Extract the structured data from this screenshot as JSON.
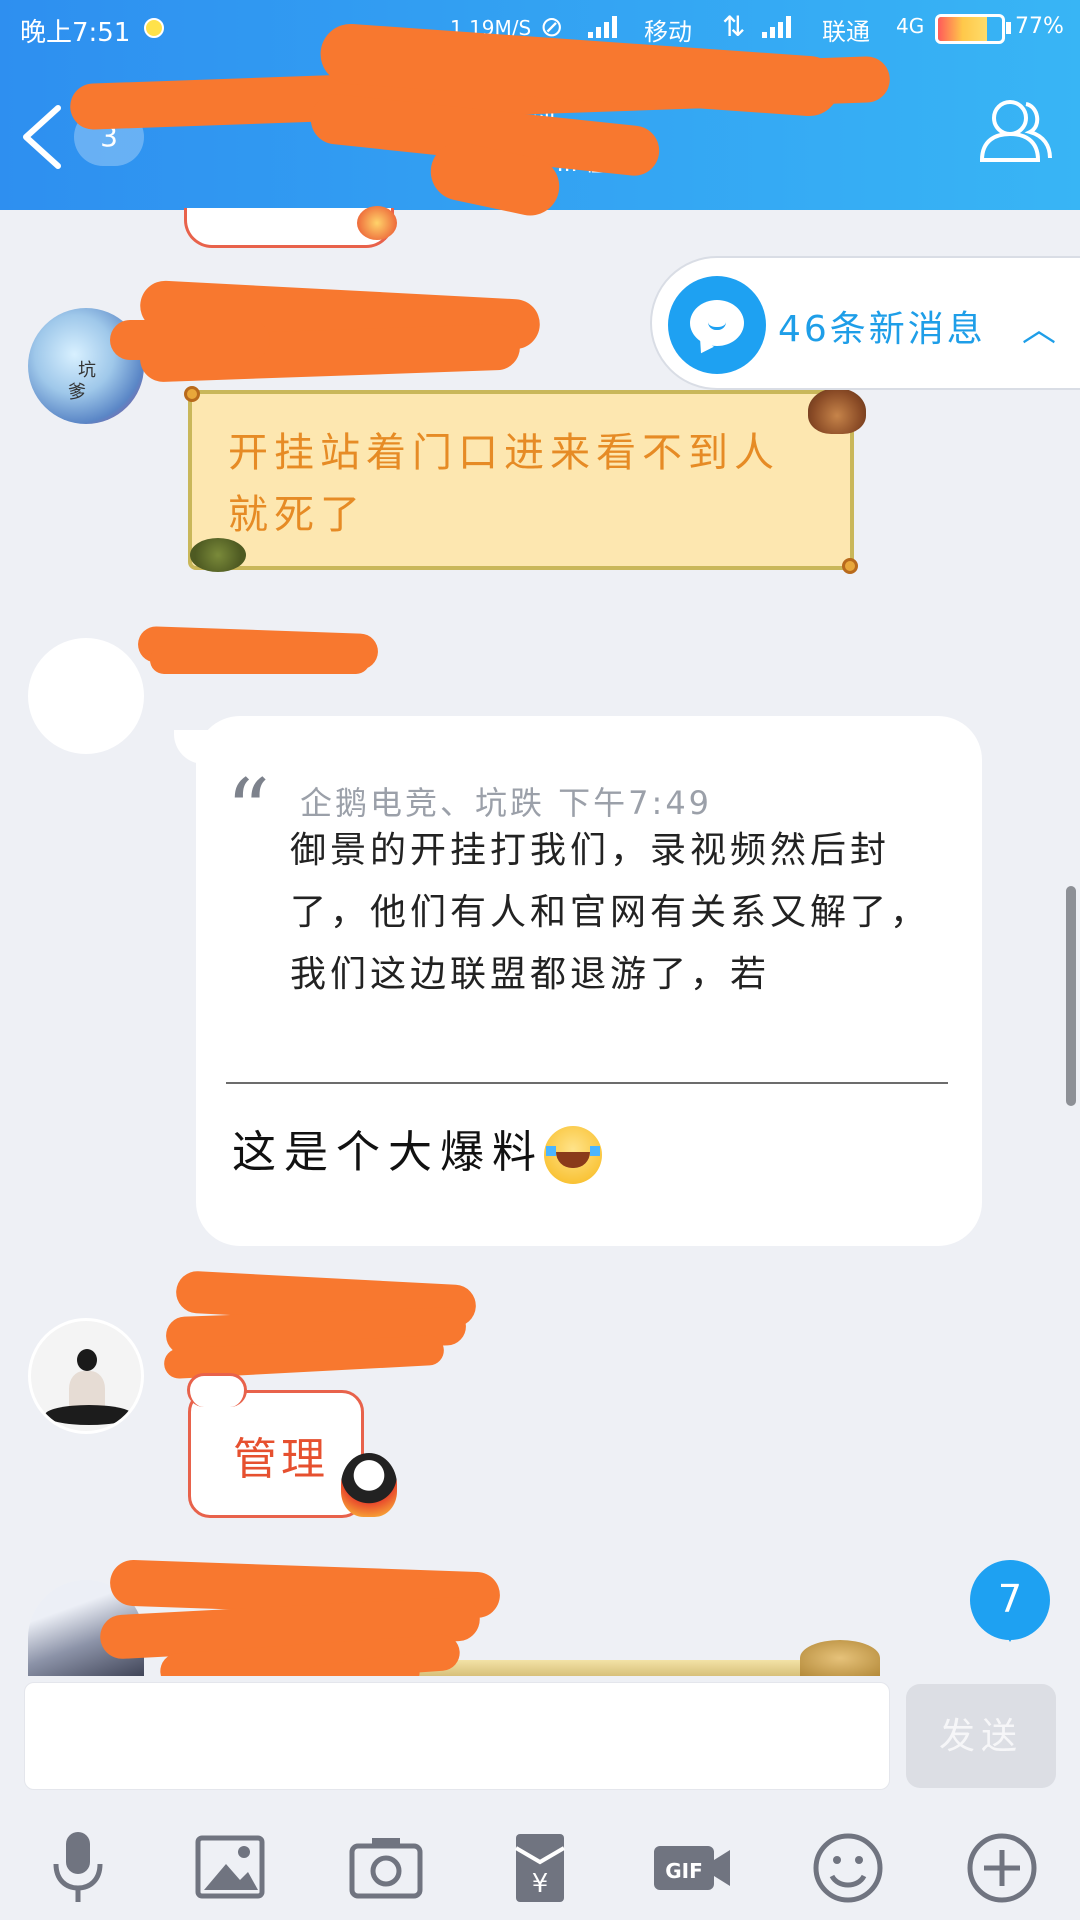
{
  "status_bar": {
    "time": "晚上7:51",
    "net_speed": "1.19M/S",
    "carrier1": "移动",
    "carrier2": "联通",
    "network": "4G",
    "battery": "77%",
    "battery_level": 0.77
  },
  "header": {
    "unread_badge": "3",
    "title": "《剑...",
    "subtitle": "(x) 67... 在线"
  },
  "new_messages": {
    "label": "46条新消息"
  },
  "messages": [
    {
      "text": "开挂站着门口进来看不到人就死了"
    },
    {
      "quote_meta": "企鹅电竞、坑跌  下午7:49",
      "quote_text": "御景的开挂打我们，录视频然后封了，他们有人和官网有关系又解了，我们这边联盟都退游了，若",
      "reply": "这是个大爆料"
    },
    {
      "text": "管理"
    }
  ],
  "avatar_text": [
    "坑",
    "爹"
  ],
  "unread_count": "7",
  "input": {
    "placeholder": "",
    "send_label": "发送"
  },
  "toolbar": [
    "mic-icon",
    "image-icon",
    "camera-icon",
    "red-packet-icon",
    "gif-icon",
    "emoji-icon",
    "plus-icon"
  ],
  "colors": {
    "header_start": "#2e8ff0",
    "header_end": "#38b5f5",
    "accent": "#1ea1f2",
    "redaction": "#f8782f"
  }
}
